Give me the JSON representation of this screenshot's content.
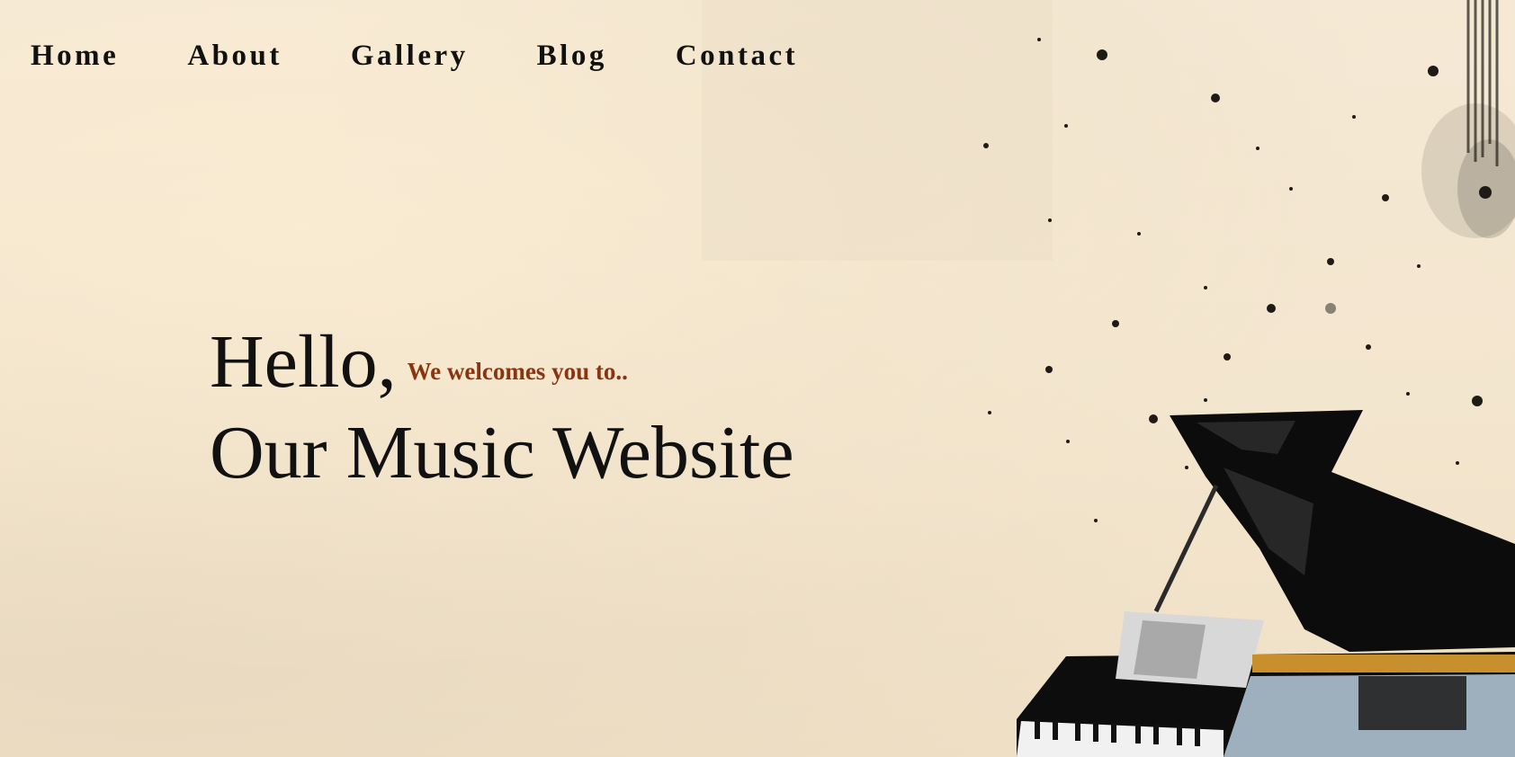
{
  "nav": {
    "items": [
      {
        "label": "Home"
      },
      {
        "label": "About"
      },
      {
        "label": "Gallery"
      },
      {
        "label": "Blog"
      },
      {
        "label": "Contact"
      }
    ]
  },
  "hero": {
    "greeting": "Hello,",
    "tagline": "We welcomes you to..",
    "title": "Our Music Website"
  },
  "colors": {
    "background": "#f4e7d1",
    "text": "#111111",
    "accent": "#8b3510"
  },
  "icons": {
    "illustration": "grand-piano-collage-illustration"
  }
}
